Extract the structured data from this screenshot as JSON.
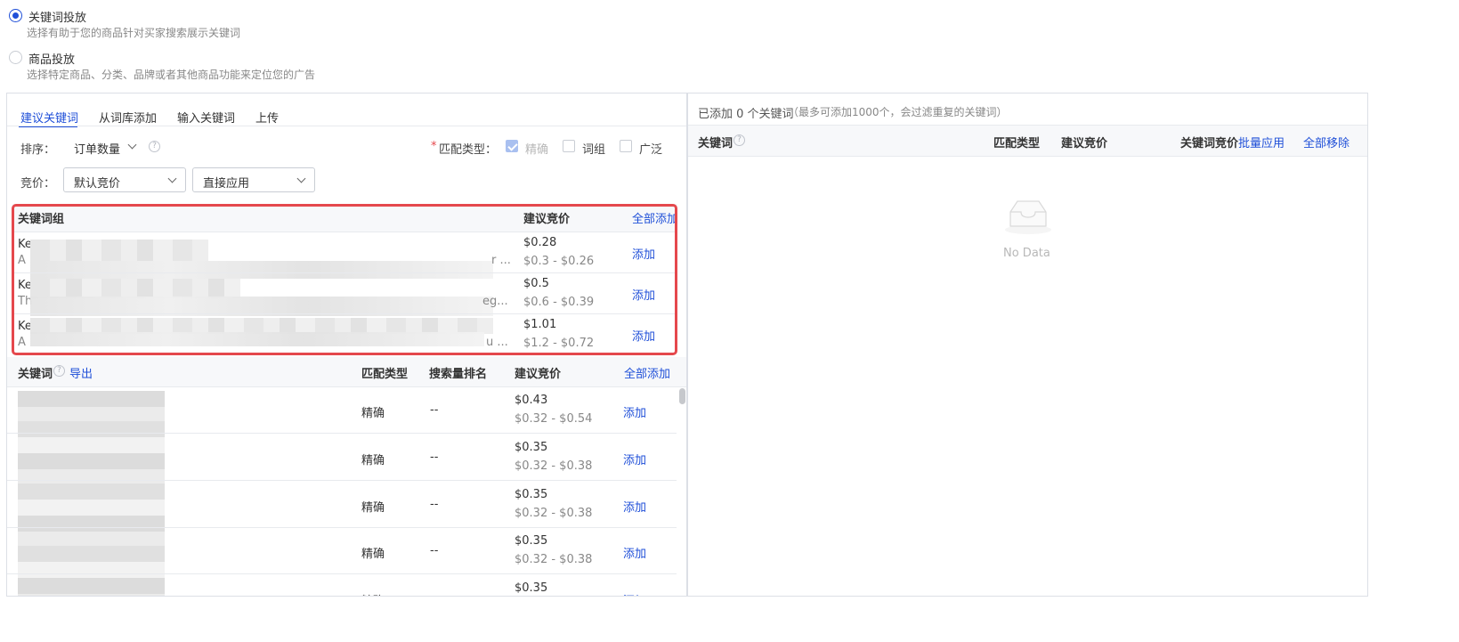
{
  "targeting": {
    "keyword": {
      "title": "关键词投放",
      "desc": "选择有助于您的商品针对买家搜索展示关键词"
    },
    "product": {
      "title": "商品投放",
      "desc": "选择特定商品、分类、品牌或者其他商品功能来定位您的广告"
    }
  },
  "tabs": [
    "建议关键词",
    "从词库添加",
    "输入关键词",
    "上传"
  ],
  "controls": {
    "sort_label": "排序：",
    "sort_value": "订单数量",
    "match_star": "*",
    "match_label": "匹配类型：",
    "match_options": [
      "精确",
      "词组",
      "广泛"
    ],
    "bid_label": "竞价：",
    "bid_value": "默认竞价",
    "apply_value": "直接应用"
  },
  "groups": {
    "headers": {
      "group": "关键词组",
      "bid": "建议竞价",
      "add_all": "全部添加"
    },
    "rows": [
      {
        "name": "Ke",
        "desc": "A",
        "tail": "r ...",
        "bid": "$0.28",
        "range": "$0.3 - $0.26",
        "add": "添加"
      },
      {
        "name": "Ke",
        "desc": "Th",
        "tail": "eg...",
        "bid": "$0.5",
        "range": "$0.6 - $0.39",
        "add": "添加"
      },
      {
        "name": "Ke",
        "desc": "A",
        "tail": "u ...",
        "bid": "$1.01",
        "range": "$1.2 - $0.72",
        "add": "添加"
      }
    ]
  },
  "keywords": {
    "headers": {
      "keyword": "关键词",
      "export": "导出",
      "match": "匹配类型",
      "rank": "搜索量排名",
      "bid": "建议竞价",
      "add_all": "全部添加"
    },
    "rows": [
      {
        "match": "精确",
        "rank": "--",
        "bid": "$0.43",
        "range": "$0.32 - $0.54",
        "add": "添加"
      },
      {
        "match": "精确",
        "rank": "--",
        "bid": "$0.35",
        "range": "$0.32 - $0.38",
        "add": "添加"
      },
      {
        "match": "精确",
        "rank": "--",
        "bid": "$0.35",
        "range": "$0.32 - $0.38",
        "add": "添加"
      },
      {
        "match": "精确",
        "rank": "--",
        "bid": "$0.35",
        "range": "$0.32 - $0.38",
        "add": "添加"
      },
      {
        "match": "精确",
        "bid": "$0.35",
        "add": "添加"
      }
    ]
  },
  "right": {
    "summary": "已添加 0 个关键词",
    "note": "（最多可添加1000个，会过滤重复的关键词）",
    "headers": {
      "keyword": "关键词",
      "match": "匹配类型",
      "bid": "建议竞价",
      "kw_bid": "关键词竞价",
      "batch": "批量应用",
      "remove_all": "全部移除"
    },
    "empty": "No Data"
  },
  "colors": {
    "accent": "#1f4fd8",
    "highlight": "#e5484d"
  }
}
